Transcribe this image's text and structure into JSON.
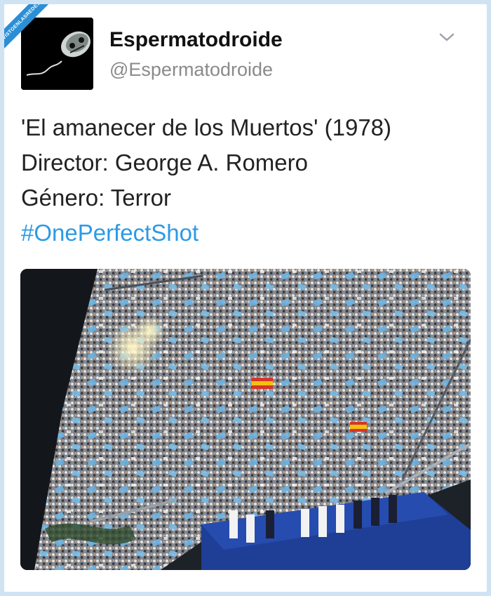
{
  "watermark": {
    "text": "VISTOENLASREDES"
  },
  "tweet": {
    "display_name": "Espermatodroide",
    "handle": "@Espermatodroide",
    "lines": [
      "'El amanecer de los Muertos' (1978)",
      "Director: George A. Romero",
      "Género: Terror"
    ],
    "hashtag": "#OnePerfectShot"
  },
  "icons": {
    "avatar": "sperm-skull-avatar",
    "menu": "chevron-down-icon"
  },
  "colors": {
    "background": "#cfe3f3",
    "hashtag": "#2b9ae6",
    "handle": "#8a8a8a",
    "stage": "#1f3f96"
  }
}
